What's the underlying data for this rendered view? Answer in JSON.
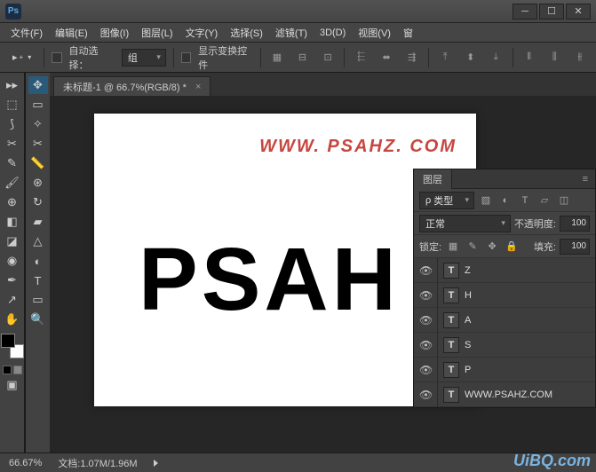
{
  "titlebar": {
    "app": "Ps"
  },
  "menubar": {
    "items": [
      "文件(F)",
      "编辑(E)",
      "图像(I)",
      "图层(L)",
      "文字(Y)",
      "选择(S)",
      "滤镜(T)",
      "3D(D)",
      "视图(V)",
      "窗"
    ]
  },
  "optbar": {
    "auto_select": "自动选择：",
    "group": "组",
    "show_transform": "显示变换控件"
  },
  "doc_tab": {
    "title": "未标题-1 @ 66.7%(RGB/8) *"
  },
  "canvas": {
    "watermark": "WWW. PSAHZ. COM",
    "headline": "PSAH"
  },
  "layers": {
    "title": "图层",
    "kind": "类型",
    "blend": "正常",
    "opacity_label": "不透明度:",
    "opacity": "100",
    "lock_label": "锁定:",
    "fill_label": "填充:",
    "fill": "100",
    "items": [
      {
        "name": "Z"
      },
      {
        "name": "H"
      },
      {
        "name": "A"
      },
      {
        "name": "S"
      },
      {
        "name": "P"
      },
      {
        "name": "WWW.PSAHZ.COM"
      }
    ]
  },
  "status": {
    "zoom": "66.67%",
    "doc": "文档:1.07M/1.96M"
  },
  "brand": "UiBQ.com"
}
